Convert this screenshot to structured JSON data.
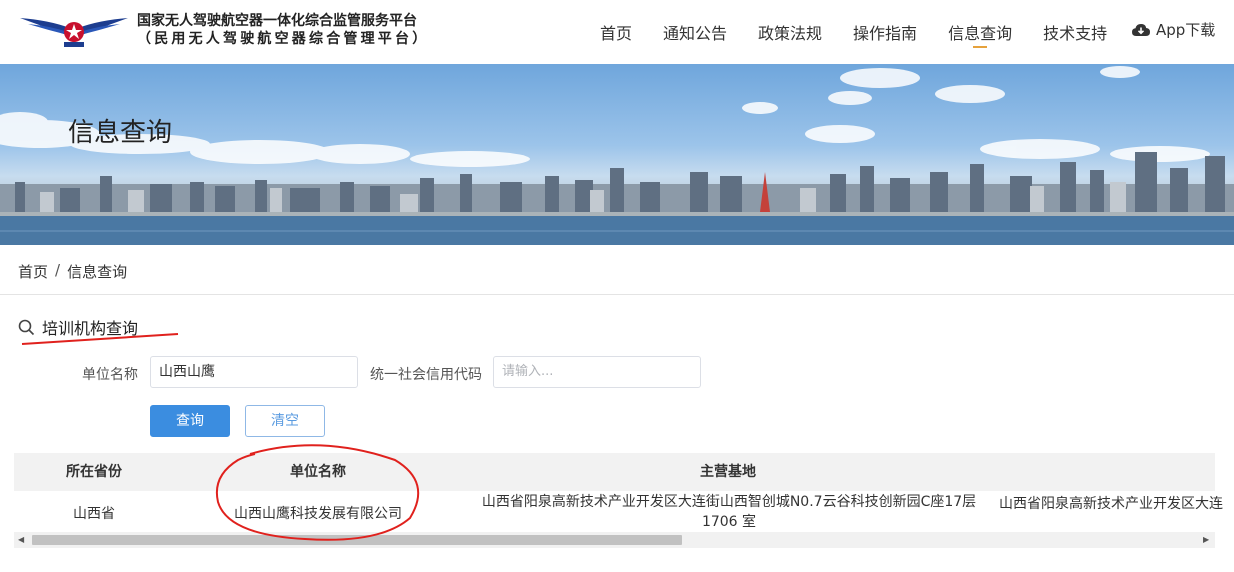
{
  "header": {
    "logo_line1": "国家无人驾驶航空器一体化综合监管服务平台",
    "logo_line2": "（民用无人驾驶航空器综合管理平台）",
    "nav": [
      "首页",
      "通知公告",
      "政策法规",
      "操作指南",
      "信息查询",
      "技术支持"
    ],
    "active_nav": "信息查询",
    "app_download": "App下载"
  },
  "banner": {
    "title": "信息查询"
  },
  "breadcrumb": {
    "home": "首页",
    "separator": "/",
    "current": "信息查询"
  },
  "search": {
    "title": "培训机构查询",
    "unit_name_label": "单位名称",
    "unit_name_value": "山西山鹰",
    "credit_code_label": "统一社会信用代码",
    "credit_code_placeholder": "请输入...",
    "query_button": "查询",
    "clear_button": "清空"
  },
  "table": {
    "headers": [
      "所在省份",
      "单位名称",
      "主营基地"
    ],
    "rows": [
      {
        "province": "山西省",
        "unit_name": "山西山鹰科技发展有限公司",
        "base_main": "山西省阳泉高新技术产业开发区大连街山西智创城N0.7云谷科技创新园C座17层1706 室",
        "base_next": "山西省阳泉高新技术产业开发区大连"
      }
    ]
  },
  "colors": {
    "primary": "#3b8de0",
    "accent_underline": "#e6a23c",
    "annotation_red": "#e0211d"
  }
}
